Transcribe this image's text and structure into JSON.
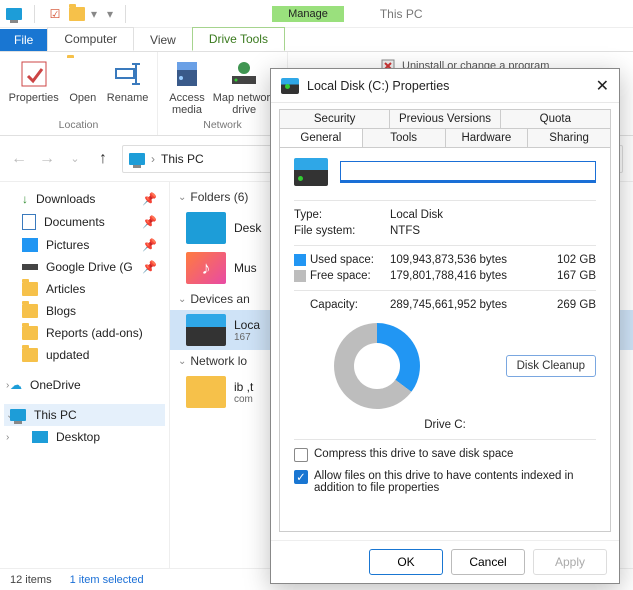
{
  "titlebar": {
    "title": "This PC",
    "manage": "Manage"
  },
  "top_tabs": {
    "file": "File",
    "computer": "Computer",
    "view": "View",
    "drive_tools": "Drive Tools"
  },
  "ribbon": {
    "properties": "Properties",
    "open": "Open",
    "rename": "Rename",
    "location_group": "Location",
    "access_media": "Access\nmedia",
    "map_drive": "Map network\ndrive",
    "network_group": "Network",
    "uninstall": "Uninstall or change a program"
  },
  "breadcrumb": {
    "label": "This PC"
  },
  "tree": {
    "downloads": "Downloads",
    "documents": "Documents",
    "pictures": "Pictures",
    "googledrive": "Google Drive (G",
    "articles": "Articles",
    "blogs": "Blogs",
    "reports": "Reports (add-ons)",
    "updated": "updated",
    "onedrive": "OneDrive",
    "thispc": "This PC",
    "desktop": "Desktop"
  },
  "content": {
    "folders_header": "Folders (6)",
    "desk": "Desk",
    "mus": "Mus",
    "devices_header": "Devices an",
    "loca": "Loca",
    "loca_sub": "167",
    "network_header": "Network lo",
    "ib": "ib ,t",
    "ib_sub": "com"
  },
  "status": {
    "items": "12 items",
    "selected": "1 item selected"
  },
  "dialog": {
    "title": "Local Disk (C:) Properties",
    "tabs_top": [
      "Security",
      "Previous Versions",
      "Quota"
    ],
    "tabs_bot": [
      "General",
      "Tools",
      "Hardware",
      "Sharing"
    ],
    "type_label": "Type:",
    "type_value": "Local Disk",
    "fs_label": "File system:",
    "fs_value": "NTFS",
    "used_label": "Used space:",
    "used_bytes": "109,943,873,536 bytes",
    "used_h": "102 GB",
    "free_label": "Free space:",
    "free_bytes": "179,801,788,416 bytes",
    "free_h": "167 GB",
    "cap_label": "Capacity:",
    "cap_bytes": "289,745,661,952 bytes",
    "cap_h": "269 GB",
    "drive_label": "Drive C:",
    "disk_cleanup": "Disk Cleanup",
    "compress": "Compress this drive to save disk space",
    "index": "Allow files on this drive to have contents indexed in addition to file properties",
    "ok": "OK",
    "cancel": "Cancel",
    "apply": "Apply"
  },
  "chart_data": {
    "type": "pie",
    "title": "Drive C:",
    "categories": [
      "Used space",
      "Free space"
    ],
    "values": [
      102,
      167
    ],
    "series": [
      {
        "name": "Used space",
        "bytes": 109943873536,
        "gb": 102,
        "color": "#2196f3"
      },
      {
        "name": "Free space",
        "bytes": 179801788416,
        "gb": 167,
        "color": "#bdbdbd"
      }
    ],
    "total": {
      "name": "Capacity",
      "bytes": 289745661952,
      "gb": 269
    }
  }
}
